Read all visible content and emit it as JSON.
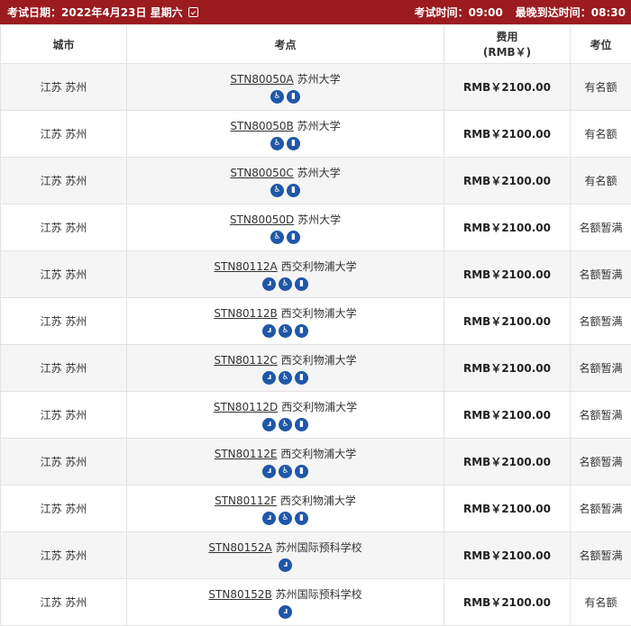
{
  "header": {
    "date_label": "考试日期：2022年4月23日 星期六",
    "calendar_icon": "calendar-check-icon",
    "exam_time_label": "考试时间：09:00",
    "latest_arrival_label": "最晚到达时间：08:30"
  },
  "table": {
    "columns": [
      "城市",
      "考点",
      "费用",
      "(RMB￥)",
      "考位"
    ],
    "rows": [
      {
        "city": "江苏 苏州",
        "code": "STN80050A",
        "name": "苏州大学",
        "icons": [
          "accessible-icon",
          "restroom-icon"
        ],
        "fee": "RMB￥2100.00",
        "seat": "有名额"
      },
      {
        "city": "江苏 苏州",
        "code": "STN80050B",
        "name": "苏州大学",
        "icons": [
          "accessible-icon",
          "restroom-icon"
        ],
        "fee": "RMB￥2100.00",
        "seat": "有名额"
      },
      {
        "city": "江苏 苏州",
        "code": "STN80050C",
        "name": "苏州大学",
        "icons": [
          "accessible-icon",
          "restroom-icon"
        ],
        "fee": "RMB￥2100.00",
        "seat": "有名额"
      },
      {
        "city": "江苏 苏州",
        "code": "STN80050D",
        "name": "苏州大学",
        "icons": [
          "accessible-icon",
          "restroom-icon"
        ],
        "fee": "RMB￥2100.00",
        "seat": "名额暂满"
      },
      {
        "city": "江苏 苏州",
        "code": "STN80112A",
        "name": "西交利物浦大学",
        "icons": [
          "hearing-icon",
          "accessible-icon",
          "restroom-icon"
        ],
        "fee": "RMB￥2100.00",
        "seat": "名额暂满"
      },
      {
        "city": "江苏 苏州",
        "code": "STN80112B",
        "name": "西交利物浦大学",
        "icons": [
          "hearing-icon",
          "accessible-icon",
          "restroom-icon"
        ],
        "fee": "RMB￥2100.00",
        "seat": "名额暂满"
      },
      {
        "city": "江苏 苏州",
        "code": "STN80112C",
        "name": "西交利物浦大学",
        "icons": [
          "hearing-icon",
          "accessible-icon",
          "restroom-icon"
        ],
        "fee": "RMB￥2100.00",
        "seat": "名额暂满"
      },
      {
        "city": "江苏 苏州",
        "code": "STN80112D",
        "name": "西交利物浦大学",
        "icons": [
          "hearing-icon",
          "accessible-icon",
          "restroom-icon"
        ],
        "fee": "RMB￥2100.00",
        "seat": "名额暂满"
      },
      {
        "city": "江苏 苏州",
        "code": "STN80112E",
        "name": "西交利物浦大学",
        "icons": [
          "hearing-icon",
          "accessible-icon",
          "restroom-icon"
        ],
        "fee": "RMB￥2100.00",
        "seat": "名额暂满"
      },
      {
        "city": "江苏 苏州",
        "code": "STN80112F",
        "name": "西交利物浦大学",
        "icons": [
          "hearing-icon",
          "accessible-icon",
          "restroom-icon"
        ],
        "fee": "RMB￥2100.00",
        "seat": "名额暂满"
      },
      {
        "city": "江苏 苏州",
        "code": "STN80152A",
        "name": "苏州国际预科学校",
        "icons": [
          "hearing-icon"
        ],
        "fee": "RMB￥2100.00",
        "seat": "名额暂满"
      },
      {
        "city": "江苏 苏州",
        "code": "STN80152B",
        "name": "苏州国际预科学校",
        "icons": [
          "hearing-icon"
        ],
        "fee": "RMB￥2100.00",
        "seat": "有名额"
      }
    ]
  },
  "colors": {
    "header_bg": "#9b1b1f",
    "icon_bg": "#1f57a8",
    "row_alt": "#f5f5f5"
  }
}
